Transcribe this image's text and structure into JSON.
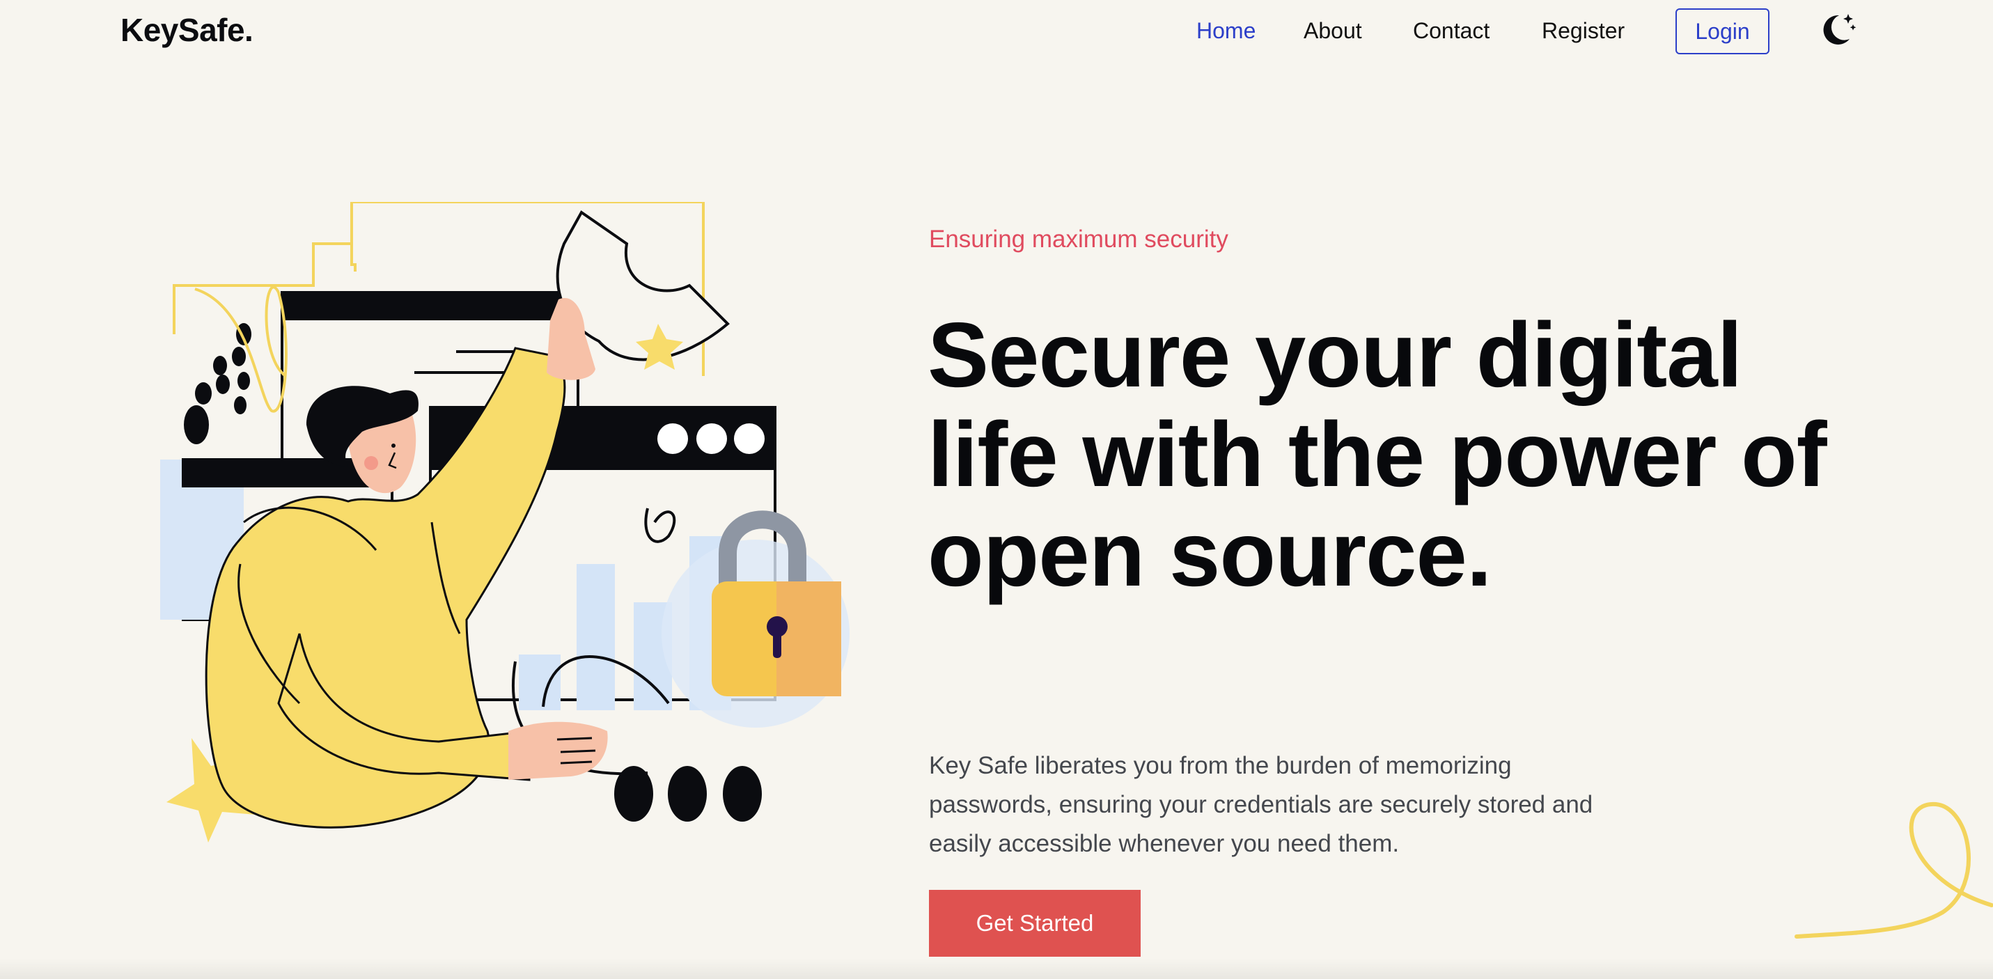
{
  "brand": {
    "logo": "KeySafe."
  },
  "nav": {
    "items": [
      {
        "label": "Home",
        "active": true
      },
      {
        "label": "About",
        "active": false
      },
      {
        "label": "Contact",
        "active": false
      },
      {
        "label": "Register",
        "active": false
      }
    ],
    "login_label": "Login",
    "theme_icon": "moon-stars-icon"
  },
  "hero": {
    "eyebrow": "Ensuring maximum security",
    "headline": "Secure your digital life with the power of open source.",
    "lead": "Key Safe liberates you from the burden of memorizing passwords, ensuring your credentials are securely stored and easily accessible whenever you need them.",
    "cta_label": "Get Started",
    "illustration_icon": "person-with-padlock-illustration"
  },
  "colors": {
    "background": "#f7f5ef",
    "accent_blue": "#2c3fc9",
    "eyebrow_red": "#e04b5f",
    "cta_red": "#df5250",
    "yellow": "#f8dc6b"
  }
}
